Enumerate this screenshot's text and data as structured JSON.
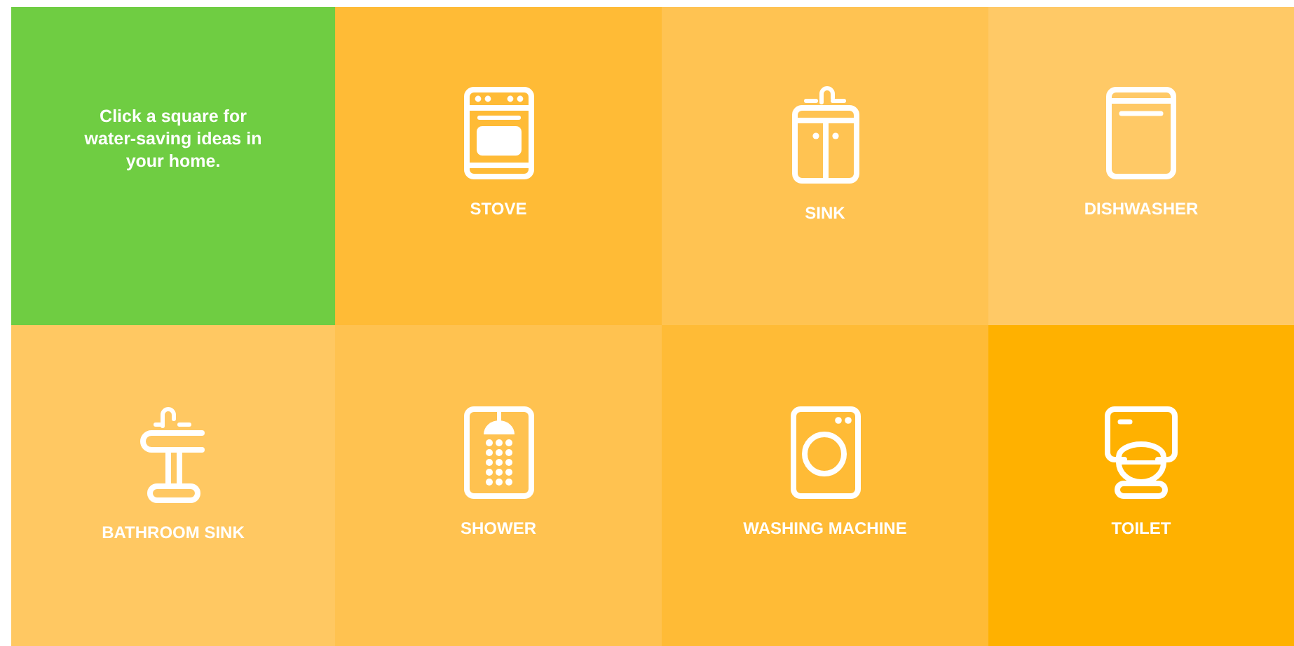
{
  "tiles": [
    {
      "kind": "intro",
      "text": "Click a square for water-saving ideas in your home.",
      "color": "#6fcd42"
    },
    {
      "kind": "appliance",
      "label": "STOVE",
      "color": "#ffbb36"
    },
    {
      "kind": "appliance",
      "label": "SINK",
      "color": "#ffc352"
    },
    {
      "kind": "appliance",
      "label": "DISHWASHER",
      "color": "#ffc966"
    },
    {
      "kind": "appliance",
      "label": "BATHROOM SINK",
      "color": "#ffc862"
    },
    {
      "kind": "appliance",
      "label": "SHOWER",
      "color": "#ffc250"
    },
    {
      "kind": "appliance",
      "label": "WASHING MACHINE",
      "color": "#ffbb36"
    },
    {
      "kind": "appliance",
      "label": "TOILET",
      "color": "#ffb100"
    }
  ]
}
